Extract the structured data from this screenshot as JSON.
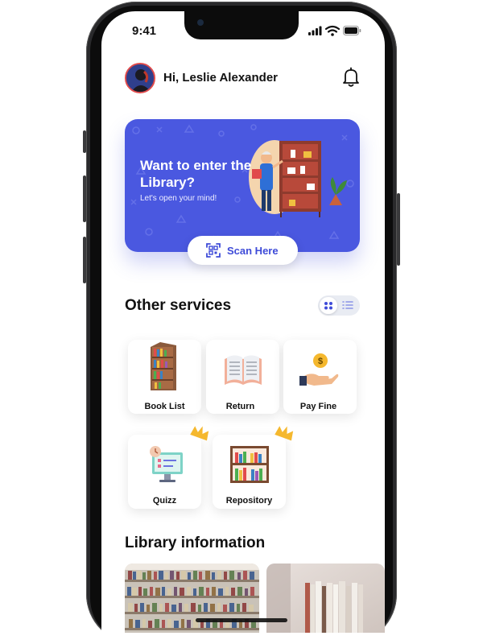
{
  "status_bar": {
    "time": "9:41"
  },
  "header": {
    "greeting": "Hi, Leslie Alexander"
  },
  "banner": {
    "title": "Want to enter the Library?",
    "subtitle": "Let's open your mind!",
    "scan_label": "Scan Here"
  },
  "services": {
    "title": "Other services",
    "items": [
      {
        "label": "Book List"
      },
      {
        "label": "Return"
      },
      {
        "label": "Pay Fine"
      },
      {
        "label": "Quizz"
      },
      {
        "label": "Repository"
      }
    ]
  },
  "library_info": {
    "title": "Library information"
  },
  "colors": {
    "accent": "#4a58e0",
    "accent_text": "#3e4bd8",
    "crown": "#f5b82e"
  }
}
